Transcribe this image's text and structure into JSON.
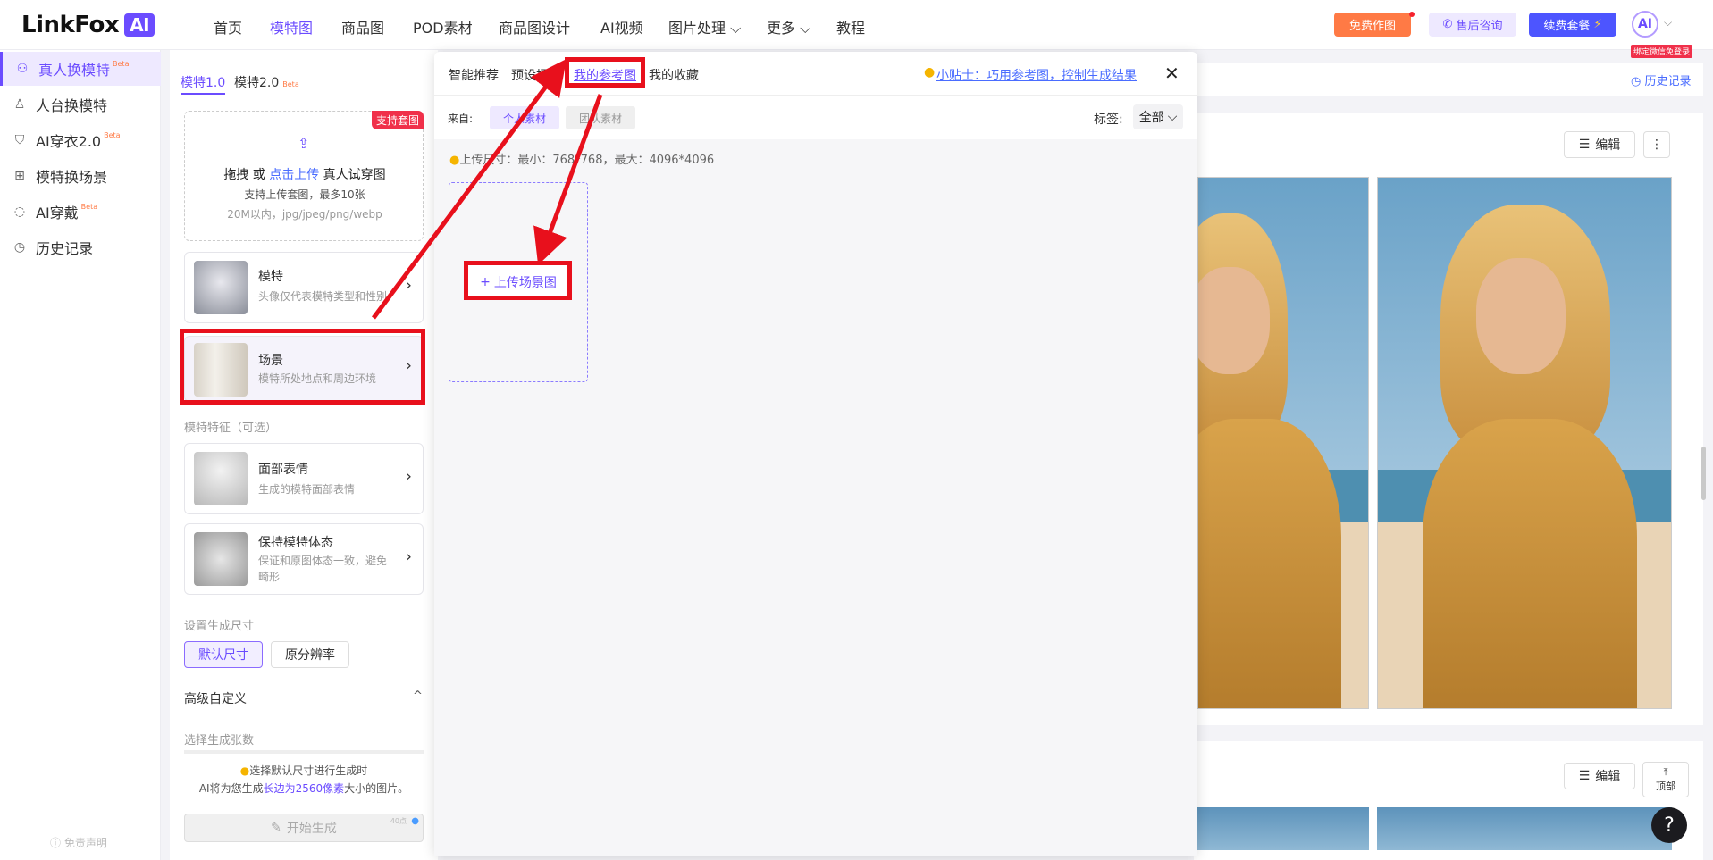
{
  "brand": {
    "name": "LinkFox",
    "ai": "AI"
  },
  "nav": [
    {
      "label": "首页",
      "active": false
    },
    {
      "label": "模特图",
      "active": true
    },
    {
      "label": "商品图",
      "active": false
    },
    {
      "label": "POD素材",
      "active": false
    },
    {
      "label": "商品图设计",
      "active": false
    },
    {
      "label": "AI视频",
      "active": false
    },
    {
      "label": "图片处理 ⌵",
      "active": false
    },
    {
      "label": "更多 ⌵",
      "active": false
    },
    {
      "label": "教程",
      "active": false
    }
  ],
  "header": {
    "free_btn": "免费作图",
    "consult_btn": "售后咨询",
    "renew_btn": "续费套餐",
    "avatar": "AI",
    "bind_tag": "绑定微信免登录"
  },
  "sidebar": {
    "items": [
      {
        "label": "真人换模特",
        "beta": "Beta",
        "icon": "hanger-icon",
        "active": true
      },
      {
        "label": "人台换模特",
        "beta": "",
        "icon": "mannequin-icon",
        "active": false
      },
      {
        "label": "AI穿衣2.0",
        "beta": "Beta",
        "icon": "shirt-icon",
        "active": false
      },
      {
        "label": "模特换场景",
        "beta": "",
        "icon": "grid-icon",
        "active": false
      },
      {
        "label": "AI穿戴",
        "beta": "Beta",
        "icon": "ring-icon",
        "active": false
      },
      {
        "label": "历史记录",
        "beta": "",
        "icon": "clock-icon",
        "active": false
      }
    ],
    "disclaimer": "免责声明"
  },
  "config": {
    "tab1": "模特1.0",
    "tab2": "模特2.0",
    "tab2_beta": "Beta",
    "upload": {
      "badge": "支持套图",
      "line1_a": "拖拽 或 ",
      "line1_link": "点击上传",
      "line1_b": " 真人试穿图",
      "line2": "支持上传套图，最多10张",
      "line3": "20M以内，jpg/jpeg/png/webp"
    },
    "model_card": {
      "title": "模特",
      "desc": "头像仅代表模特类型和性别"
    },
    "scene_card": {
      "title": "场景",
      "desc": "模特所处地点和周边环境"
    },
    "features_label": "模特特征（可选）",
    "face_card": {
      "title": "面部表情",
      "desc": "生成的模特面部表情"
    },
    "pose_card": {
      "title": "保持模特体态",
      "desc": "保证和原图体态一致，避免畸形"
    },
    "size_label": "设置生成尺寸",
    "size_default": "默认尺寸",
    "size_original": "原分辨率",
    "advanced": "高级自定义",
    "count_label": "选择生成张数",
    "note_line1": "选择默认尺寸进行生成时",
    "note_line2_a": "AI将为您生成",
    "note_line2_link": "长边为2560像素",
    "note_line2_b": "大小的图片。",
    "generate": "开始生成",
    "cost": "40点"
  },
  "modal": {
    "tabs": [
      "智能推荐",
      "预设场景",
      "我的参考图",
      "我的收藏"
    ],
    "active_tab": 2,
    "tip": "小贴士：巧用参考图，控制生成结果",
    "from_label": "来自:",
    "src_personal": "个人素材",
    "src_team": "团队素材",
    "tag_label": "标签:",
    "tag_value": "全部",
    "size_tip": "上传尺寸：最小：768*768，最大：4096*4096",
    "upload_scene": "上传场景图"
  },
  "results": {
    "history": "历史记录",
    "edit": "编辑",
    "more": "⋮",
    "top": "顶部",
    "help": "?"
  },
  "colors": {
    "accent": "#6b4cff",
    "annotation": "#e8101c",
    "orange": "#ff7a45"
  }
}
